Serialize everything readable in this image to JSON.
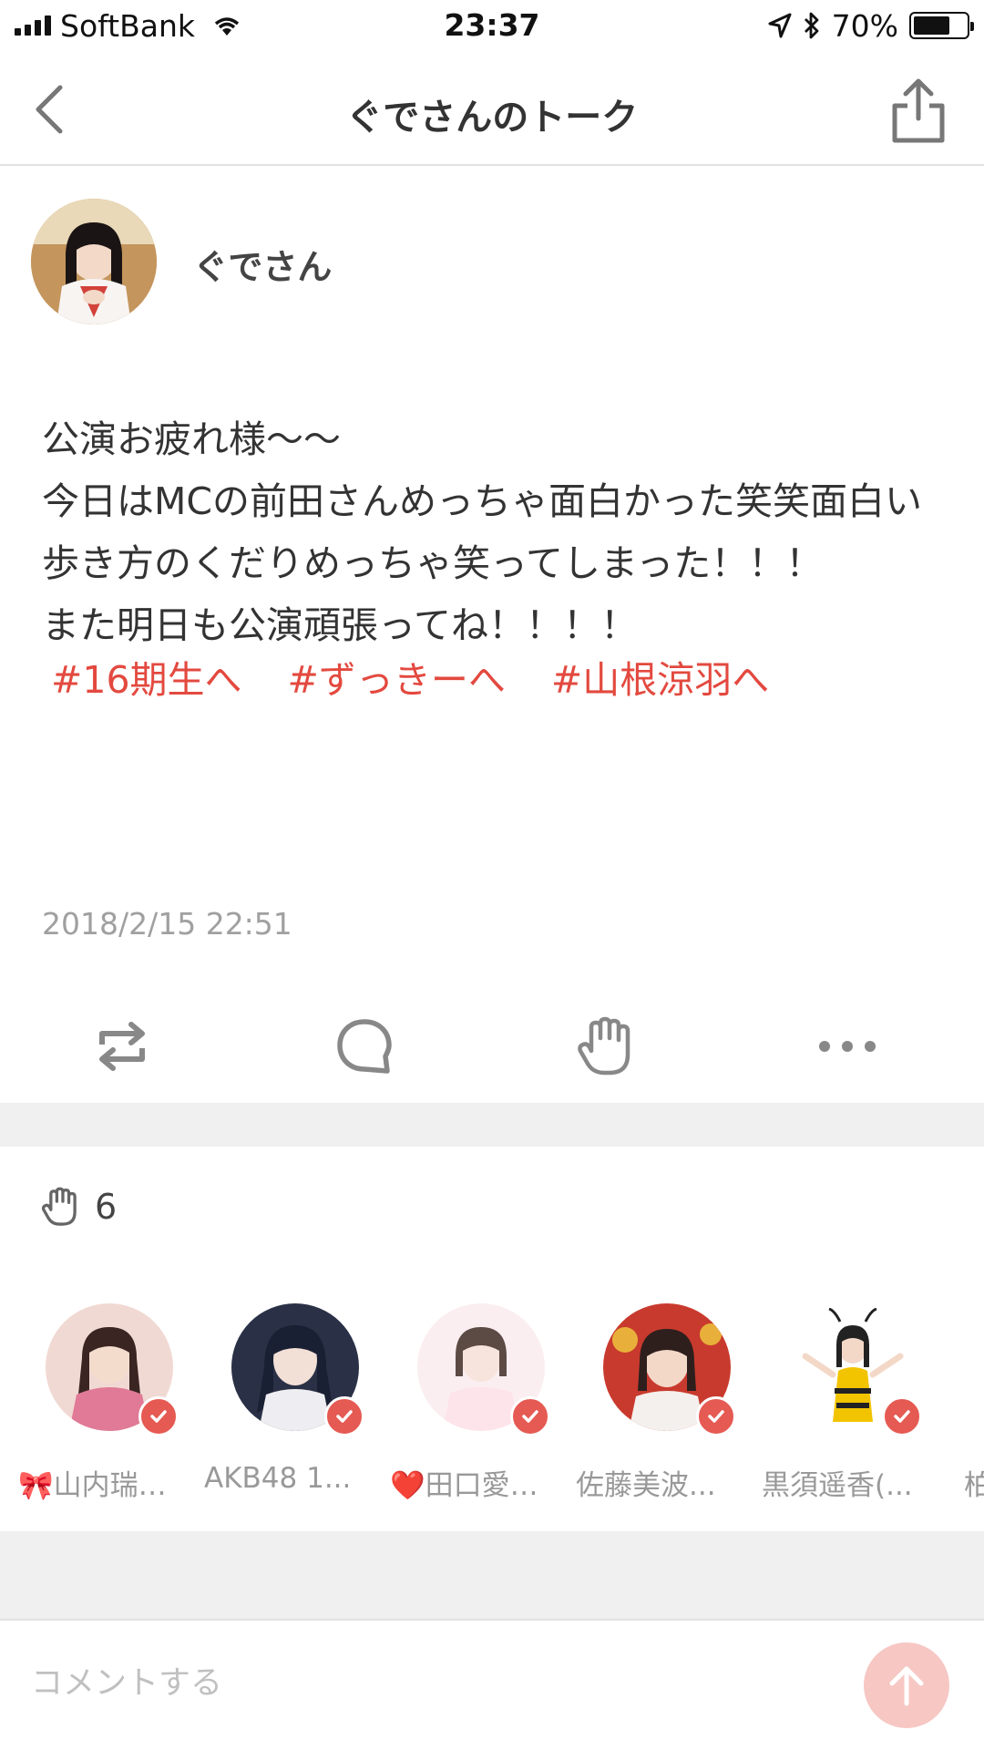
{
  "status_bar": {
    "carrier": "SoftBank",
    "time": "23:37",
    "battery_percent": "70%",
    "battery_level": 0.7,
    "icons": [
      "signal-icon",
      "wifi-icon",
      "location-icon",
      "bluetooth-icon",
      "battery-icon"
    ]
  },
  "navbar": {
    "title": "ぐでさんのトーク",
    "back_icon": "chevron-left-icon",
    "share_icon": "share-icon"
  },
  "post": {
    "author": "ぐでさん",
    "body": "公演お疲れ様〜〜\n今日はMCの前田さんめっちゃ面白かった笑笑面白い歩き方のくだりめっちゃ笑ってしまった！！！\nまた明日も公演頑張ってね！！！！",
    "tags": [
      "#16期生へ",
      "#ずっきーへ",
      "#山根涼羽へ"
    ],
    "timestamp": "2018/2/15 22:51"
  },
  "actions": {
    "items": [
      "repost-icon",
      "comment-icon",
      "clap-icon",
      "more-icon"
    ]
  },
  "likes": {
    "icon": "clap-icon",
    "count": "6",
    "users": [
      {
        "prefix": "🎀",
        "name": "山内瑞…",
        "colors": [
          "#f1d9d3",
          "#d8aab3"
        ]
      },
      {
        "prefix": "",
        "name": "AKB48 1...",
        "colors": [
          "#1c2436",
          "#e9eaef"
        ]
      },
      {
        "prefix": "❤️",
        "name": "田口愛…",
        "colors": [
          "#fbeef0",
          "#5c4a45"
        ]
      },
      {
        "prefix": "",
        "name": "佐藤美波...",
        "colors": [
          "#c93a2e",
          "#6b2f2a"
        ]
      },
      {
        "prefix": "",
        "name": "黒須遥香(...",
        "colors": [
          "#ffffff",
          "#f2c400"
        ]
      }
    ],
    "overflow_char": "柏"
  },
  "comment": {
    "placeholder": "コメントする",
    "send_icon": "arrow-up-icon"
  },
  "colors": {
    "accent": "#e3493f",
    "send_button": "#f7c7c4",
    "verified_badge": "#e55a52",
    "separator": "#f0f0f0"
  }
}
